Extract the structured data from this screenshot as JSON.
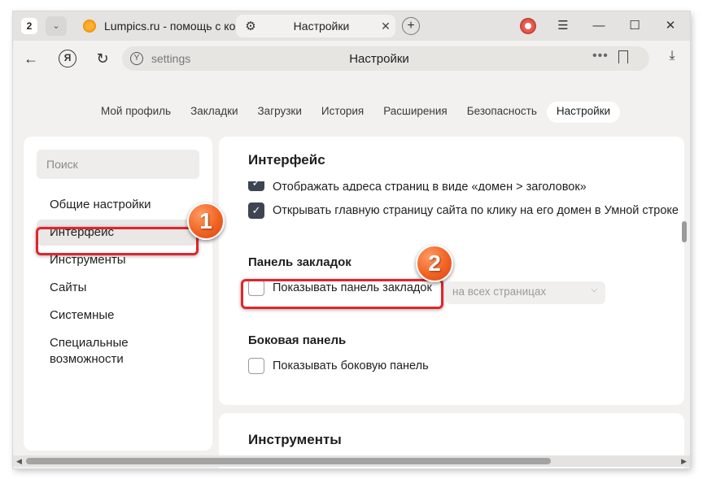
{
  "tabbar": {
    "tab_count": "2",
    "tabs": [
      {
        "title": "Lumpics.ru - помощь с компьютером"
      },
      {
        "title": "Настройки"
      }
    ]
  },
  "addressbar": {
    "url": "settings",
    "page_title": "Настройки",
    "more": "•••"
  },
  "topnav": {
    "items": [
      "Мой профиль",
      "Закладки",
      "Загрузки",
      "История",
      "Расширения",
      "Безопасность",
      "Настройки"
    ]
  },
  "sidebar": {
    "search_placeholder": "Поиск",
    "items": [
      "Общие настройки",
      "Интерфейс",
      "Инструменты",
      "Сайты",
      "Системные",
      "Специальные",
      "возможности"
    ]
  },
  "interface": {
    "title": "Интерфейс",
    "options": [
      {
        "label": "Отображать адреса страниц в виде «домен > заголовок»",
        "checked": true
      },
      {
        "label": "Открывать главную страницу сайта по клику на его домен в Умной строке",
        "checked": true
      }
    ],
    "bookmarks_panel": {
      "title": "Панель закладок",
      "label": "Показывать панель закладок",
      "checked": false,
      "select_value": "на всех страницах"
    },
    "side_panel": {
      "title": "Боковая панель",
      "label": "Показывать боковую панель",
      "checked": false
    }
  },
  "tools": {
    "title": "Инструменты"
  },
  "annotations": {
    "badge1": "1",
    "badge2": "2",
    "color": "#e0262b"
  }
}
